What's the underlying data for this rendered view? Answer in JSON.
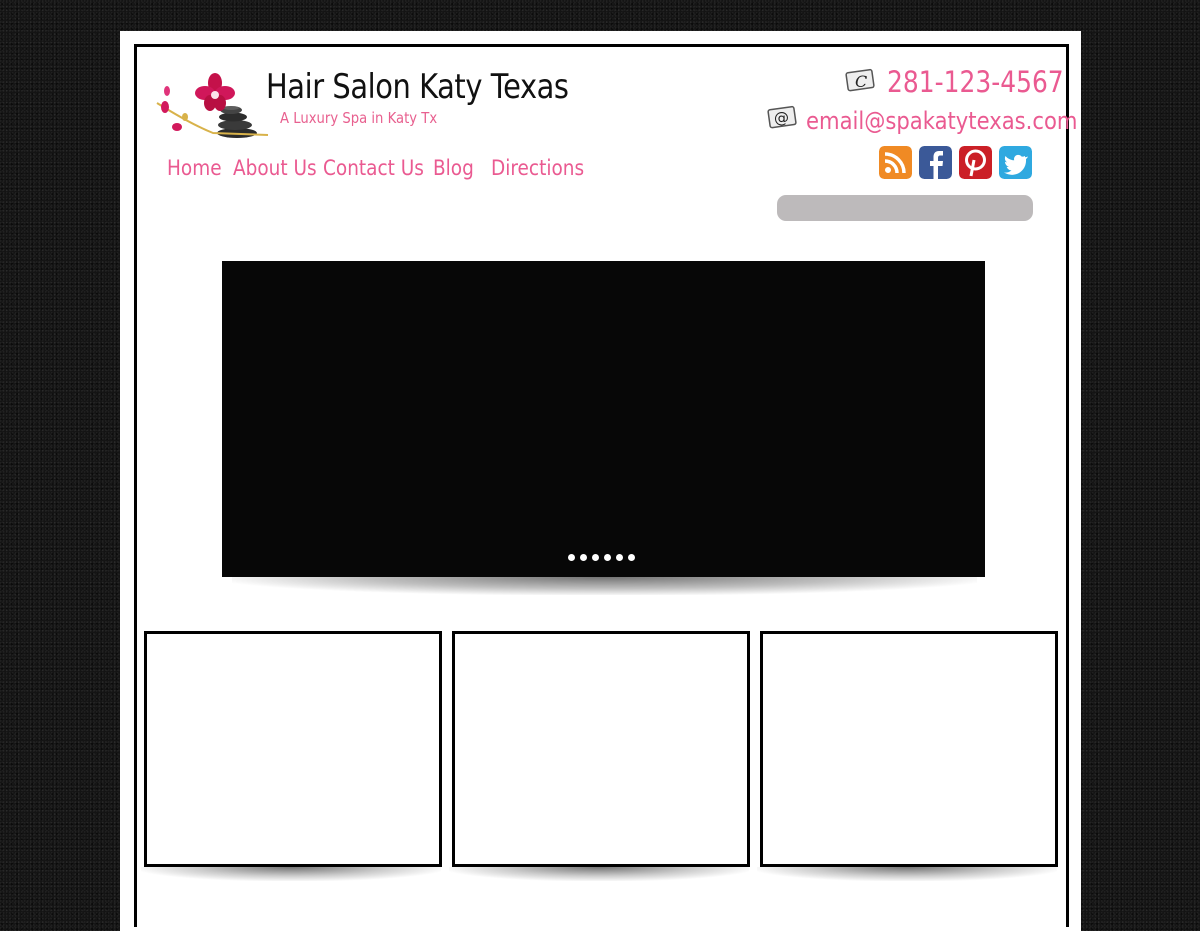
{
  "header": {
    "site_title": "Hair Salon Katy Texas",
    "tagline": "A Luxury Spa in Katy Tx",
    "logo_icon": "orchid-stones-logo"
  },
  "nav": {
    "items": [
      {
        "label": "Home"
      },
      {
        "label": "About Us"
      },
      {
        "label": "Contact Us"
      },
      {
        "label": "Blog"
      },
      {
        "label": "Directions"
      }
    ]
  },
  "contact": {
    "phone": "281-123-4567",
    "phone_icon": "phone-icon",
    "email": "email@spakatytexas.com",
    "email_icon": "email-icon"
  },
  "social": [
    {
      "name": "rss-icon",
      "color": "#f08a24"
    },
    {
      "name": "facebook-icon",
      "color": "#3b5998"
    },
    {
      "name": "pinterest-icon",
      "color": "#cb2027"
    },
    {
      "name": "twitter-icon",
      "color": "#2fa9e0"
    }
  ],
  "slider": {
    "slide_count": 6,
    "background": "#070707"
  },
  "colors": {
    "accent": "#ea5a91",
    "search_bar": "#bdbabb"
  }
}
